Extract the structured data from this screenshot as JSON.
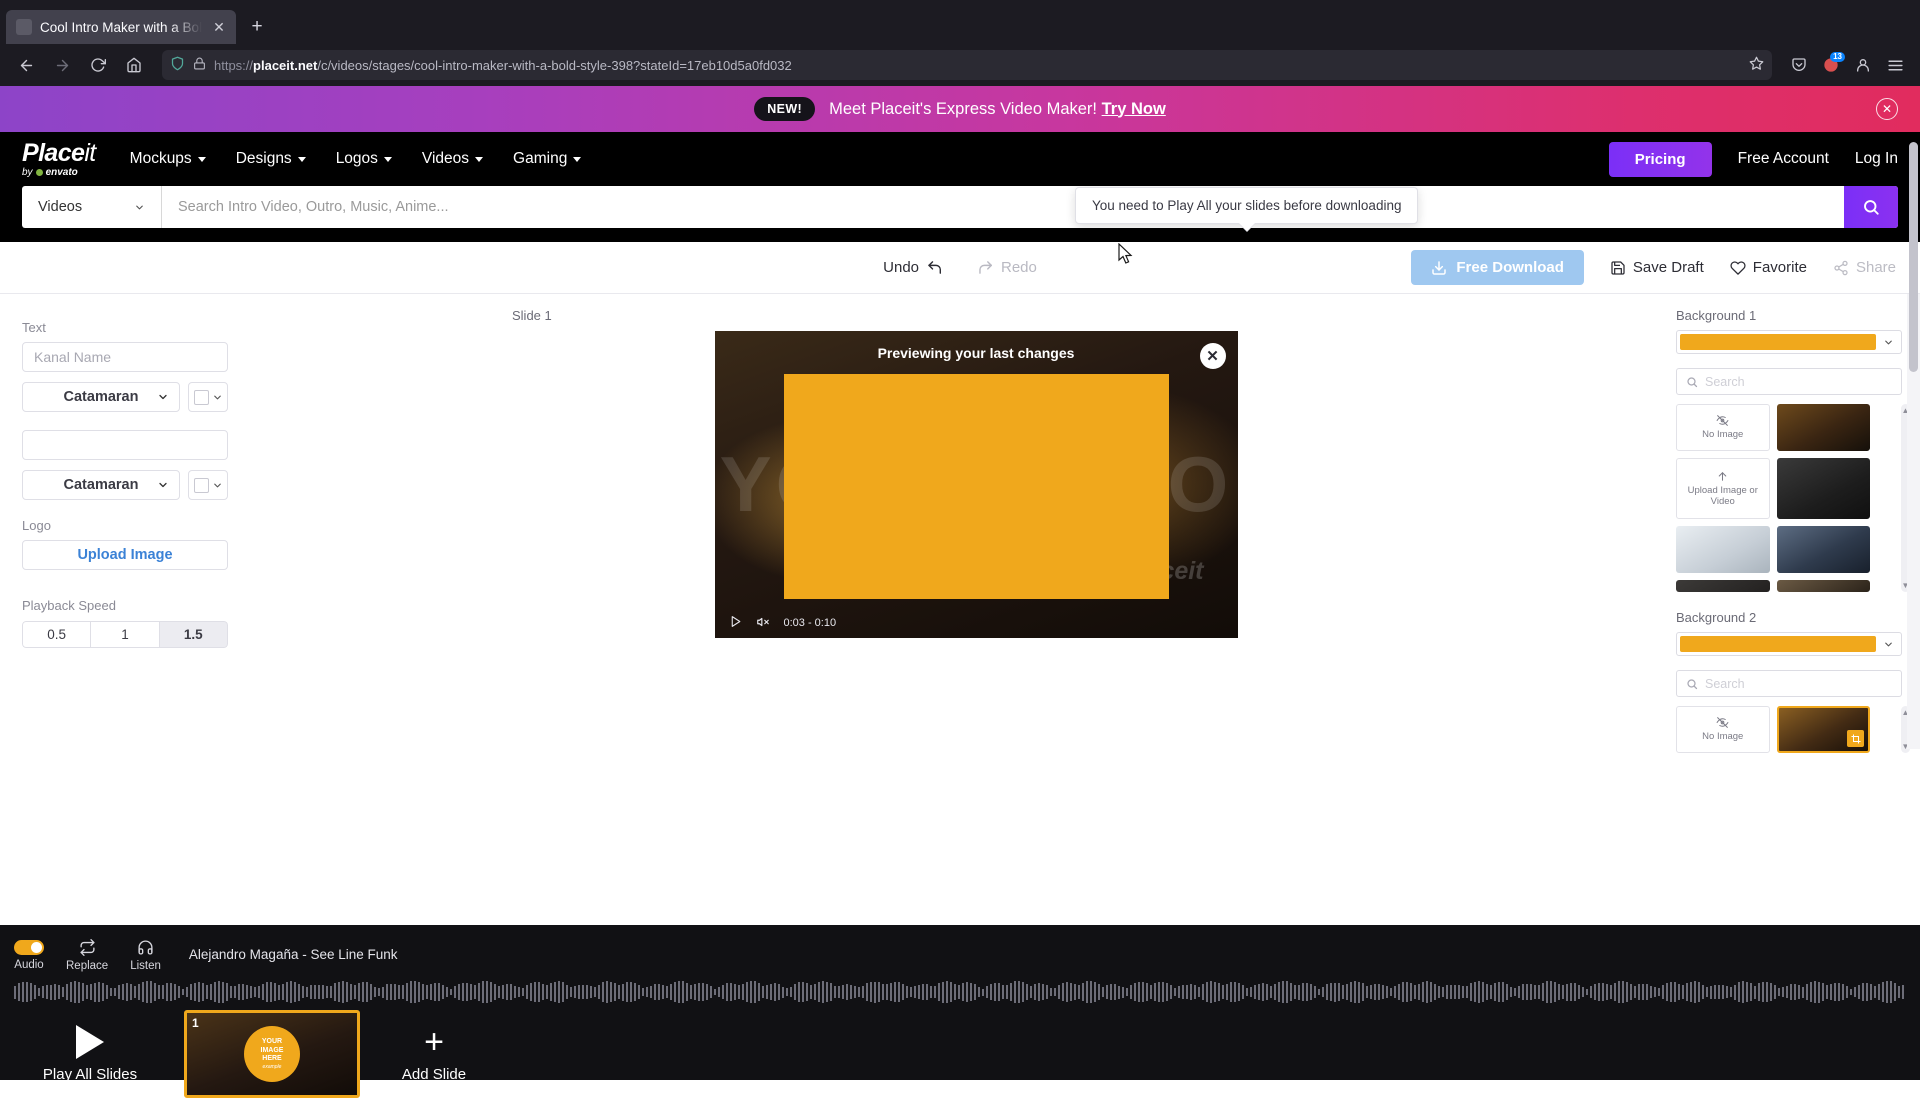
{
  "browser": {
    "tab": {
      "title": "Cool Intro Maker with a Bold St",
      "close_icon": "close-icon"
    },
    "newtab_icon": "plus-icon",
    "nav": {
      "back_icon": "back-arrow-icon",
      "forward_icon": "forward-arrow-icon",
      "reload_icon": "reload-icon",
      "home_icon": "home-icon"
    },
    "url": {
      "scheme": "https://",
      "domain": "placeit.net",
      "path": "/c/videos/stages/cool-intro-maker-with-a-bold-style-398?stateId=17eb10d5a0fd032",
      "shield_icon": "shield-icon",
      "lock_icon": "lock-icon",
      "bookmark_icon": "star-icon"
    },
    "toolbar_right": {
      "pocket_icon": "pocket-icon",
      "extensions_icon": "extensions-icon",
      "extensions_count": "13",
      "account_icon": "account-icon",
      "menu_icon": "hamburger-menu-icon"
    }
  },
  "promo": {
    "badge": "NEW!",
    "text": "Meet Placeit's Express Video Maker!",
    "cta": "Try Now",
    "close_icon": "close-icon",
    "gradient_from": "#8d44c8",
    "gradient_to": "#e12c5e"
  },
  "site_header": {
    "logo": {
      "name": "Place",
      "name_it": "it",
      "byline": "by",
      "brand": "envato"
    },
    "nav": [
      {
        "label": "Mockups"
      },
      {
        "label": "Designs"
      },
      {
        "label": "Logos"
      },
      {
        "label": "Videos"
      },
      {
        "label": "Gaming"
      }
    ],
    "pricing": "Pricing",
    "free_account": "Free Account",
    "log_in": "Log In",
    "accent": "#7b2ff7"
  },
  "search": {
    "category": "Videos",
    "placeholder": "Search Intro Video, Outro, Music, Anime...",
    "value": "",
    "search_icon": "search-icon"
  },
  "editor_toolbar": {
    "undo": "Undo",
    "redo": "Redo",
    "undo_icon": "undo-arrow-icon",
    "redo_icon": "redo-arrow-icon",
    "download": "Free Download",
    "download_icon": "download-icon",
    "save_draft": "Save Draft",
    "save_icon": "save-icon",
    "favorite": "Favorite",
    "favorite_icon": "heart-icon",
    "share": "Share",
    "share_icon": "share-icon",
    "tooltip": "You need to Play All your slides before downloading"
  },
  "left_panel": {
    "text_label": "Text",
    "text_1": {
      "value": "",
      "placeholder": "Kanal Name",
      "font": "Catamaran",
      "color": "#ffffff"
    },
    "text_2": {
      "value": "",
      "placeholder": "",
      "font": "Catamaran",
      "color": "#ffffff"
    },
    "logo_label": "Logo",
    "upload_label": "Upload Image",
    "playback_label": "Playback Speed",
    "speeds": [
      "0.5",
      "1",
      "1.5"
    ],
    "speed_selected": "1.5"
  },
  "canvas": {
    "slide_label": "Slide 1",
    "preview_message": "Previewing your last changes",
    "close_icon": "close-icon",
    "overlay_color": "#f0a81c",
    "ghost_text": "YOUR LOGO",
    "watermark": "Placeit",
    "play_icon": "play-icon",
    "mute_icon": "mute-icon",
    "time": "0:03 - 0:10"
  },
  "right_panel": {
    "bg1": {
      "label": "Background 1",
      "color": "#f0a81c",
      "search_placeholder": "Search",
      "search_icon": "search-icon",
      "options": [
        {
          "type": "none",
          "label": "No Image",
          "icon": "no-image-icon"
        },
        {
          "type": "image",
          "tone": "warm"
        },
        {
          "type": "upload",
          "label": "Upload Image or Video",
          "icon": "upload-icon"
        },
        {
          "type": "image",
          "tone": "dark"
        },
        {
          "type": "image",
          "tone": "snow"
        },
        {
          "type": "image",
          "tone": "night"
        }
      ]
    },
    "bg2": {
      "label": "Background 2",
      "color": "#f0a81c",
      "search_placeholder": "Search",
      "search_icon": "search-icon",
      "options": [
        {
          "type": "none",
          "label": "No Image",
          "icon": "no-image-icon"
        },
        {
          "type": "image",
          "tone": "warm",
          "selected": true,
          "crop_icon": "crop-icon"
        }
      ]
    }
  },
  "bottom": {
    "audio_label": "Audio",
    "replace_label": "Replace",
    "listen_label": "Listen",
    "replace_icon": "replace-icon",
    "listen_icon": "headphones-icon",
    "track": "Alejandro Magaña - See Line Funk",
    "audio_on": true,
    "play_all": "Play All Slides",
    "play_icon": "play-icon",
    "add_slide": "Add Slide",
    "add_icon": "plus-icon",
    "slides": [
      {
        "number": "1",
        "badge_line1": "YOUR",
        "badge_line2": "IMAGE",
        "badge_line3": "HERE",
        "badge_line4": "example"
      }
    ]
  }
}
